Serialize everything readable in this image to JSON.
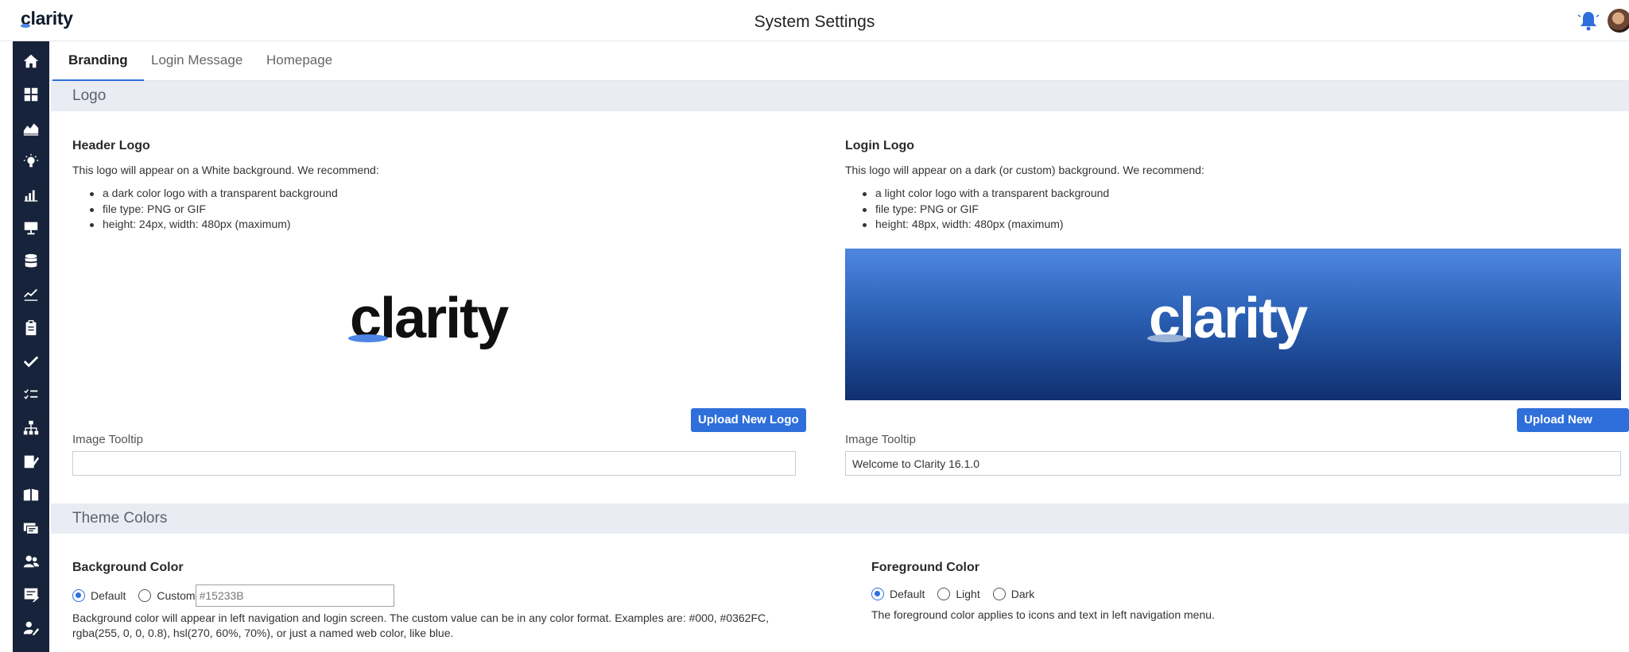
{
  "header": {
    "brand": "clarity",
    "title": "System Settings"
  },
  "sidebar": {
    "icons": [
      "home-icon",
      "dashboard-icon",
      "area-chart-icon",
      "lightbulb-icon",
      "bar-chart-icon",
      "presentation-icon",
      "database-icon",
      "line-chart-icon",
      "clipboard-icon",
      "checkmark-icon",
      "checklist-icon",
      "hierarchy-icon",
      "edit-document-icon",
      "book-icon",
      "id-card-icon",
      "people-icon",
      "form-icon",
      "user-edit-icon"
    ]
  },
  "tabs": [
    {
      "label": "Branding",
      "active": true
    },
    {
      "label": "Login Message",
      "active": false
    },
    {
      "label": "Homepage",
      "active": false
    }
  ],
  "logo_section": {
    "title": "Logo",
    "header_logo": {
      "title": "Header Logo",
      "description": "This logo will appear on a White background. We recommend:",
      "bullets": [
        "a dark color logo with a transparent background",
        "file type: PNG or GIF",
        "height: 24px, width: 480px (maximum)"
      ],
      "preview_text": "clarity",
      "upload_label": "Upload New Logo",
      "tooltip_label": "Image Tooltip",
      "tooltip_value": ""
    },
    "login_logo": {
      "title": "Login Logo",
      "description": "This logo will appear on a dark (or custom) background. We recommend:",
      "bullets": [
        "a light color logo with a transparent background",
        "file type: PNG or GIF",
        "height: 48px, width: 480px (maximum)"
      ],
      "preview_text": "clarity",
      "upload_label": "Upload New Logo",
      "tooltip_label": "Image Tooltip",
      "tooltip_value": "Welcome to Clarity 16.1.0"
    }
  },
  "theme_section": {
    "title": "Theme Colors",
    "background": {
      "title": "Background Color",
      "options": [
        {
          "label": "Default",
          "checked": true
        },
        {
          "label": "Custom",
          "checked": false
        }
      ],
      "custom_placeholder": "#15233B",
      "help_line1": "Background color will appear in left navigation and login screen. The custom value can be in any color format. Examples are: #000, #0362FC,",
      "help_line2": "rgba(255, 0, 0, 0.8), hsl(270, 60%, 70%), or just a named web color, like blue."
    },
    "foreground": {
      "title": "Foreground Color",
      "options": [
        {
          "label": "Default",
          "checked": true
        },
        {
          "label": "Light",
          "checked": false
        },
        {
          "label": "Dark",
          "checked": false
        }
      ],
      "help": "The foreground color applies to icons and text in left navigation menu."
    }
  },
  "colors": {
    "accent": "#2f6fdb",
    "sidebar_bg": "#17233b",
    "section_bg": "#e9ecf3"
  }
}
